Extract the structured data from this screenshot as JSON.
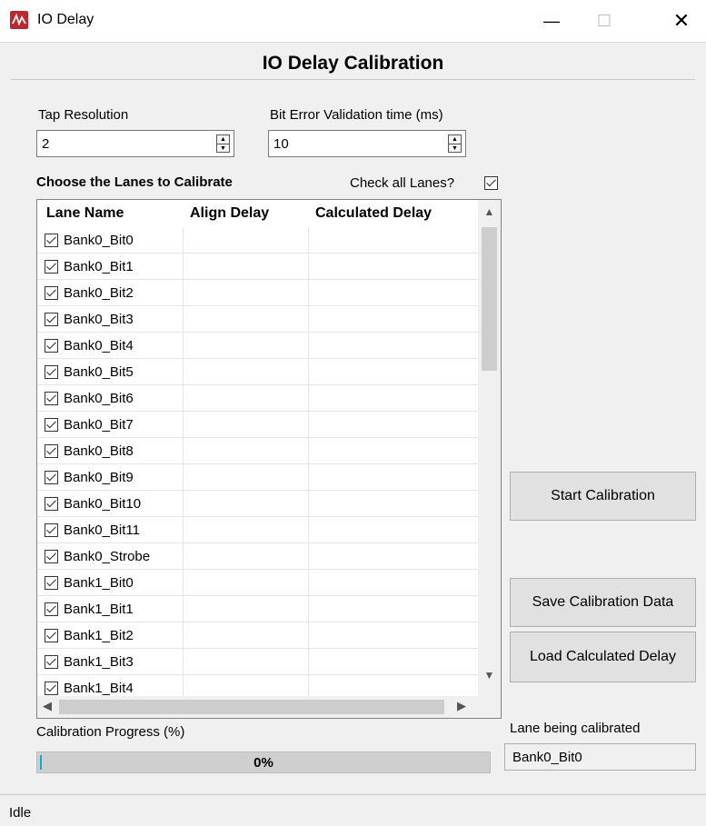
{
  "window": {
    "title": "IO Delay",
    "minimize": "—",
    "maximize": "☐",
    "close": "✕"
  },
  "heading": "IO Delay Calibration",
  "tap_resolution": {
    "label": "Tap Resolution",
    "value": "2"
  },
  "bit_error": {
    "label": "Bit Error Validation time (ms)",
    "value": "10"
  },
  "lanes": {
    "label": "Choose the Lanes to Calibrate",
    "check_all_label": "Check all Lanes?",
    "check_all": true,
    "columns": [
      "Lane Name",
      "Align Delay",
      "Calculated Delay"
    ],
    "rows": [
      {
        "name": "Bank0_Bit0",
        "checked": true
      },
      {
        "name": "Bank0_Bit1",
        "checked": true
      },
      {
        "name": "Bank0_Bit2",
        "checked": true
      },
      {
        "name": "Bank0_Bit3",
        "checked": true
      },
      {
        "name": "Bank0_Bit4",
        "checked": true
      },
      {
        "name": "Bank0_Bit5",
        "checked": true
      },
      {
        "name": "Bank0_Bit6",
        "checked": true
      },
      {
        "name": "Bank0_Bit7",
        "checked": true
      },
      {
        "name": "Bank0_Bit8",
        "checked": true
      },
      {
        "name": "Bank0_Bit9",
        "checked": true
      },
      {
        "name": "Bank0_Bit10",
        "checked": true
      },
      {
        "name": "Bank0_Bit11",
        "checked": true
      },
      {
        "name": "Bank0_Strobe",
        "checked": true
      },
      {
        "name": "Bank1_Bit0",
        "checked": true
      },
      {
        "name": "Bank1_Bit1",
        "checked": true
      },
      {
        "name": "Bank1_Bit2",
        "checked": true
      },
      {
        "name": "Bank1_Bit3",
        "checked": true
      },
      {
        "name": "Bank1_Bit4",
        "checked": true
      }
    ]
  },
  "buttons": {
    "start": "Start Calibration",
    "save": "Save Calibration Data",
    "load": "Load Calculated Delay"
  },
  "progress": {
    "label": "Calibration Progress (%)",
    "value": 0,
    "text": "0%"
  },
  "lane_being_calibrated": {
    "label": "Lane being calibrated",
    "value": "Bank0_Bit0"
  },
  "status": "Idle",
  "colors": {
    "progress_fill": "#06b0d0",
    "app_icon": "#c0262d"
  }
}
